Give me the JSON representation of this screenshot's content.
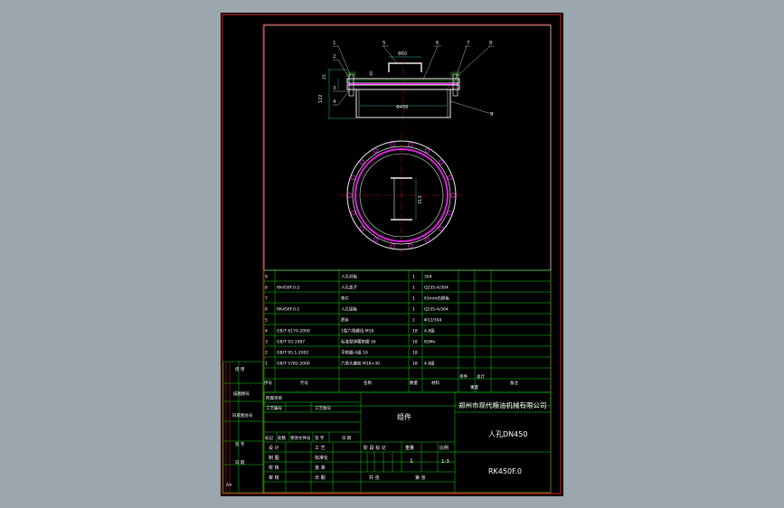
{
  "drawing": {
    "part_name": "人孔DN450",
    "drawing_no": "RK450F.0",
    "company": "郑州市现代粮油机械有限公司",
    "component_type": "组件",
    "scale": "1:3",
    "quantity": "1",
    "sheet_left": "共 张",
    "sheet_right": "第 张",
    "corner_mark": "AA"
  },
  "dimensions": {
    "top_width": "Φ50",
    "inner_diameter": "Φ456",
    "center_span": "313",
    "height_total": "122",
    "h_small_1": "25",
    "h_small_2": "40"
  },
  "callouts": [
    "1",
    "2",
    "3",
    "4",
    "5",
    "6",
    "7",
    "8",
    "9"
  ],
  "bom": {
    "rows": [
      {
        "no": "9",
        "code": "",
        "name": "人孔衬板",
        "qty": "1",
        "material": "304",
        "weight": ""
      },
      {
        "no": "8",
        "code": "RK450F.0-2",
        "name": "人孔盖子",
        "qty": "1",
        "material": "Q235-A/304",
        "weight": ""
      },
      {
        "no": "7",
        "code": "",
        "name": "垫片",
        "qty": "1",
        "material": "δ3mm石棉板",
        "weight": ""
      },
      {
        "no": "6",
        "code": "RK450F.0-1",
        "name": "人孔接板",
        "qty": "1",
        "material": "Q235-A/304",
        "weight": ""
      },
      {
        "no": "5",
        "code": "",
        "name": "把手",
        "qty": "1",
        "material": "Φ12/304",
        "weight": ""
      },
      {
        "no": "4",
        "code": "GB/T 6170-2000",
        "name": "1型六角螺母 M16",
        "qty": "18",
        "material": "4.8级",
        "weight": ""
      },
      {
        "no": "3",
        "code": "GB/T 93-1987",
        "name": "标准型弹簧垫圈 16",
        "qty": "18",
        "material": "65Mn",
        "weight": ""
      },
      {
        "no": "2",
        "code": "GB/T 95.1-2002",
        "name": "平垫圈-A级 16",
        "qty": "18",
        "material": "",
        "weight": ""
      },
      {
        "no": "1",
        "code": "GB/T 5782-2000",
        "name": "六角头螺栓 M16×30",
        "qty": "18",
        "material": "4.8级",
        "weight": ""
      }
    ],
    "header": {
      "no": "序号",
      "code": "代号",
      "name": "名称",
      "qty": "数量",
      "material": "材料",
      "unit_w": "单件",
      "total_w": "总计",
      "weight": "重量",
      "remark": "备注"
    }
  },
  "title_block": {
    "left_side_labels": [
      "借 用",
      "描图图号",
      "旧底图总号",
      "签 字",
      "日 期"
    ],
    "rows_labels": {
      "design_item": "所属项目",
      "process_no": "工艺编号",
      "process_ref": "工艺图号",
      "mark": "标记",
      "count": "处数",
      "change_doc": "更改文件号",
      "sign": "签 字",
      "date": "日 期",
      "design": "设 计",
      "draw": "制 图",
      "check": "校 核",
      "review": "审 核",
      "process": "工 艺",
      "standard": "标准化",
      "approve": "批 准",
      "day": "日 期",
      "stage": "阶 段 标 记",
      "weight": "重量",
      "ratio": "比例"
    }
  },
  "colors": {
    "frame_red": "#e02020",
    "grid_green": "#11d611",
    "outline_white": "#f0f0f0",
    "dim_cyan": "#40e0e0",
    "circle_magenta": "#e020e0",
    "background": "#9ba6ae"
  }
}
